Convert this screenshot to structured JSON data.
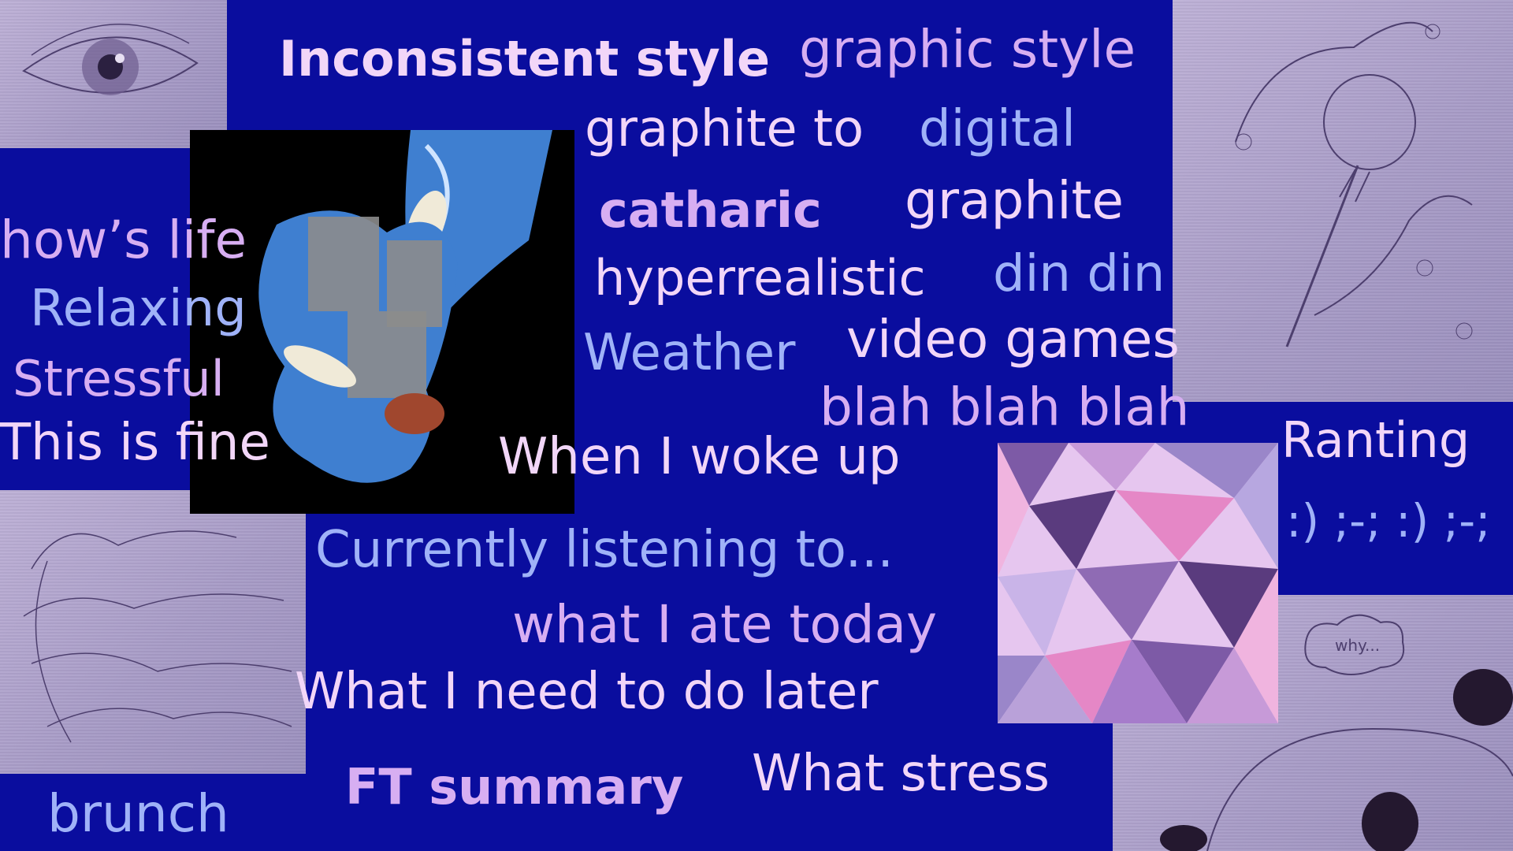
{
  "words": {
    "inconsistent": "Inconsistent style",
    "graphic_style": "graphic style",
    "graphite_to": "graphite to",
    "digital": "digital",
    "catharic": "catharic",
    "graphite": "graphite",
    "hyperrealistic": "hyperrealistic",
    "din_din": "din din",
    "weather": "Weather",
    "video_games": "video games",
    "blah": "blah blah blah",
    "woke_up": "When I woke up",
    "hows_life": "how’s life",
    "relaxing": "Relaxing",
    "stressful": "Stressful",
    "this_is_fine": "This is fine",
    "ranting": "Ranting",
    "emoticons": ":) ;-;  :) ;-;",
    "listening": "Currently listening to...",
    "ate_today": "what I ate today",
    "do_later": "What I need to do later",
    "ft_summary": "FT summary",
    "what_stress": "What stress",
    "brunch": "brunch"
  },
  "cloud_text": "why...",
  "colors": {
    "background": "#0a0d9e",
    "pink": "#f2d6f8",
    "lilac": "#d7aef2",
    "blue": "#9fb2f8",
    "paper": "#b3a7d0"
  }
}
